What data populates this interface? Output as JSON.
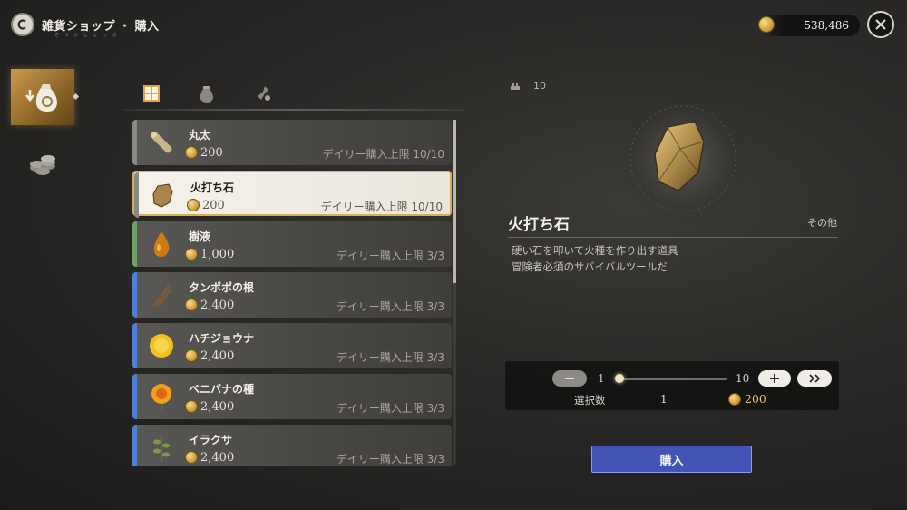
{
  "header": {
    "shop_name": "雑貨ショップ",
    "separator": "・",
    "mode": "購入",
    "subtitle": "さ つ か し ょ っ ぷ"
  },
  "currency": {
    "icon": "gold-coin-icon",
    "amount": "538,486"
  },
  "sidebar": {
    "tabs": [
      {
        "icon": "item-bag-icon",
        "active": true
      },
      {
        "icon": "coin-stack-icon",
        "active": false
      }
    ]
  },
  "category_tabs": [
    {
      "icon": "all-items-icon",
      "active": true
    },
    {
      "icon": "sack-icon",
      "active": false
    },
    {
      "icon": "flask-icon",
      "active": false
    }
  ],
  "items": [
    {
      "name": "丸太",
      "price": "200",
      "limit": "デイリー購入上限 10/10",
      "bar_color": "#8b8985",
      "icon": "log-icon"
    },
    {
      "name": "火打ち石",
      "price": "200",
      "limit": "デイリー購入上限 10/10",
      "bar_color": "#8b8985",
      "icon": "flint-icon",
      "selected": true
    },
    {
      "name": "樹液",
      "price": "1,000",
      "limit": "デイリー購入上限 3/3",
      "bar_color": "#6fa06a",
      "icon": "sap-icon"
    },
    {
      "name": "タンポポの根",
      "price": "2,400",
      "limit": "デイリー購入上限 3/3",
      "bar_color": "#4f7fd6",
      "icon": "root-icon"
    },
    {
      "name": "ハチジョウナ",
      "price": "2,400",
      "limit": "デイリー購入上限 3/3",
      "bar_color": "#4f7fd6",
      "icon": "yellow-flower-icon"
    },
    {
      "name": "ベニバナの種",
      "price": "2,400",
      "limit": "デイリー購入上限 3/3",
      "bar_color": "#4f7fd6",
      "icon": "safflower-icon"
    },
    {
      "name": "イラクサ",
      "price": "2,400",
      "limit": "デイリー購入上限 3/3",
      "bar_color": "#4f7fd6",
      "icon": "nettle-icon"
    }
  ],
  "detail": {
    "stock_icon": "stock-icon",
    "stock": "10",
    "name": "火打ち石",
    "category": "その他",
    "description_1": "硬い石を叩いて火種を作り出す道具",
    "description_2": "冒険者必須のサバイバルツールだ"
  },
  "quantity": {
    "min": "1",
    "max": "10",
    "slider_fraction": 0,
    "label": "選択数",
    "selected": "1",
    "total": "200"
  },
  "buy_button": {
    "label": "購入",
    "color": "#4454b6"
  }
}
